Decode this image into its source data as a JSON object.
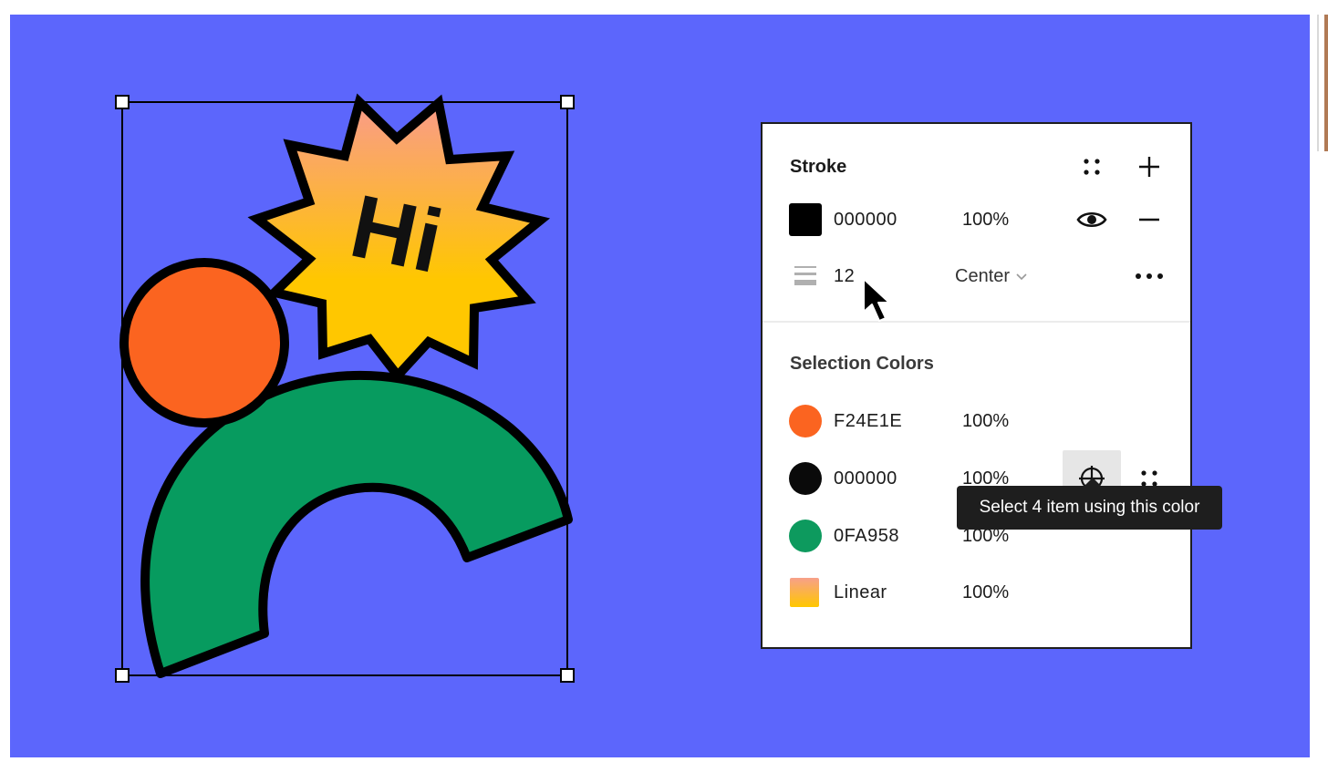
{
  "stroke": {
    "title": "Stroke",
    "color": {
      "hex": "000000",
      "opacity": "100%",
      "swatch": "#000000"
    },
    "weight": "12",
    "align": "Center",
    "icons": [
      "grid-dots-icon",
      "plus-icon",
      "eye-icon",
      "minus-icon",
      "stroke-weight-icon",
      "chevron-down-icon",
      "more-icon"
    ]
  },
  "selection_colors": {
    "title": "Selection Colors",
    "items": [
      {
        "hex": "F24E1E",
        "opacity": "100%",
        "swatch": "#fb6420"
      },
      {
        "hex": "000000",
        "opacity": "100%",
        "swatch": "#0a0a0a"
      },
      {
        "hex": "0FA958",
        "opacity": "100%",
        "swatch": "#0d9a5e"
      },
      {
        "hex": "Linear",
        "opacity": "100%",
        "swatch": "linear-gradient(#f7a08a,#ffc700)"
      }
    ],
    "icons": [
      "target-icon",
      "grid-dots-icon"
    ]
  },
  "tooltip": {
    "text": "Select 4 item using this color"
  },
  "artwork": {
    "text": "Hi",
    "colors": {
      "canvas": "#5c66fc",
      "orange": "#fb6420",
      "green": "#079b5f",
      "star_top": "#f99b8a",
      "star_bottom": "#ffc700",
      "stroke": "#000000"
    }
  }
}
